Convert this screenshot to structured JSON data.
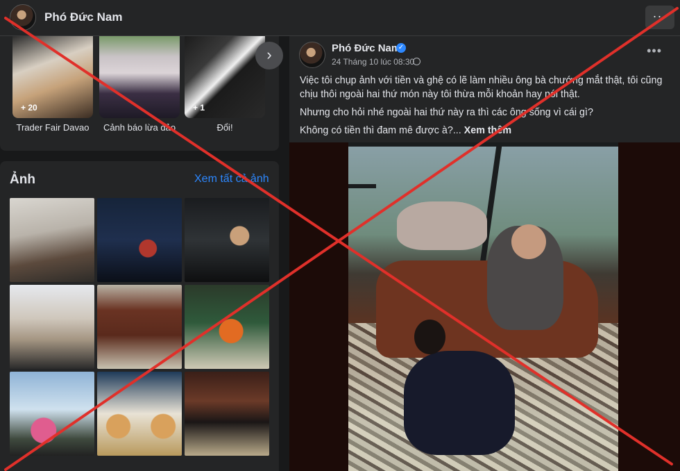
{
  "header": {
    "name": "Phó Đức Nam"
  },
  "highlights": {
    "items": [
      {
        "label": "Trader Fair Davao",
        "count": "+ 20"
      },
      {
        "label": "Cảnh báo lừa đảo",
        "count": ""
      },
      {
        "label": "Đổi!",
        "count": "+ 1"
      }
    ]
  },
  "photos": {
    "title": "Ảnh",
    "see_all": "Xem tất cả ảnh"
  },
  "post": {
    "author": "Phó Đức Nam",
    "date": "24 Tháng 10 lúc 08:30",
    "paragraphs": [
      "Việc tôi chụp ảnh với tiền và ghệ có lẽ làm nhiều ông bà chướng mắt thật, tôi cũng chịu thôi ngoài hai thứ món này tôi thừa mỗi khoản hay nói thật.",
      "Nhưng cho hỏi nhé ngoài hai thứ này ra thì các ông sống vì cái gì?",
      "Không có tiền thì đam mê được à?..."
    ],
    "see_more": "Xem thêm"
  },
  "colors": {
    "background": "#18191a",
    "card": "#242526",
    "link": "#2d88ff",
    "overlay_x": "#e0302a"
  },
  "icons": [
    "verified-icon",
    "globe-icon",
    "more-icon",
    "chevron-right-icon"
  ]
}
